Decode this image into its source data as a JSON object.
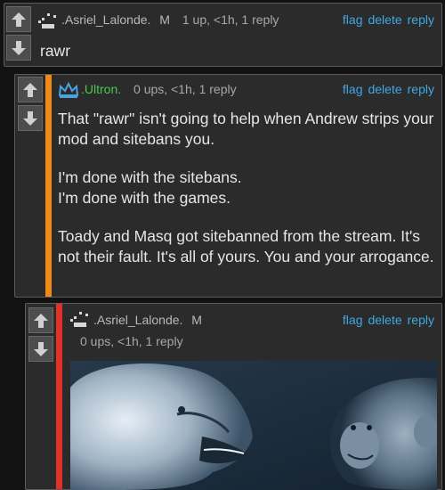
{
  "colors": {
    "bg": "#121212",
    "card": "#2b2b2b",
    "link": "#3fa9e2",
    "orange_accent": "#f08a17",
    "red_accent": "#e3312a",
    "green_user": "#4cc94c"
  },
  "actions": {
    "flag": "flag",
    "delete": "delete",
    "reply": "reply"
  },
  "comments": [
    {
      "user": ".Asriel_Lalonde.",
      "badge": "M",
      "meta": "1 up, <1h, 1 reply",
      "body": [
        "rawr"
      ]
    },
    {
      "user": ".Ultron.",
      "meta": "0 ups, <1h, 1 reply",
      "body": [
        "That \"rawr\" isn't going to help when Andrew strips your mod and sitebans you.",
        "I'm done with the sitebans.\nI'm done with the games.",
        "Toady and Masq got sitebanned from the stream. It's not their fault. It's all of yours. You and your arrogance."
      ]
    },
    {
      "user": ".Asriel_Lalonde.",
      "badge": "M",
      "meta": "0 ups, <1h, 1 reply",
      "image": "lioness-and-chimpanzee-image"
    }
  ],
  "icons": {
    "upvote": "arrow-up-icon",
    "downvote": "arrow-down-icon",
    "crown": "crown-icon"
  }
}
